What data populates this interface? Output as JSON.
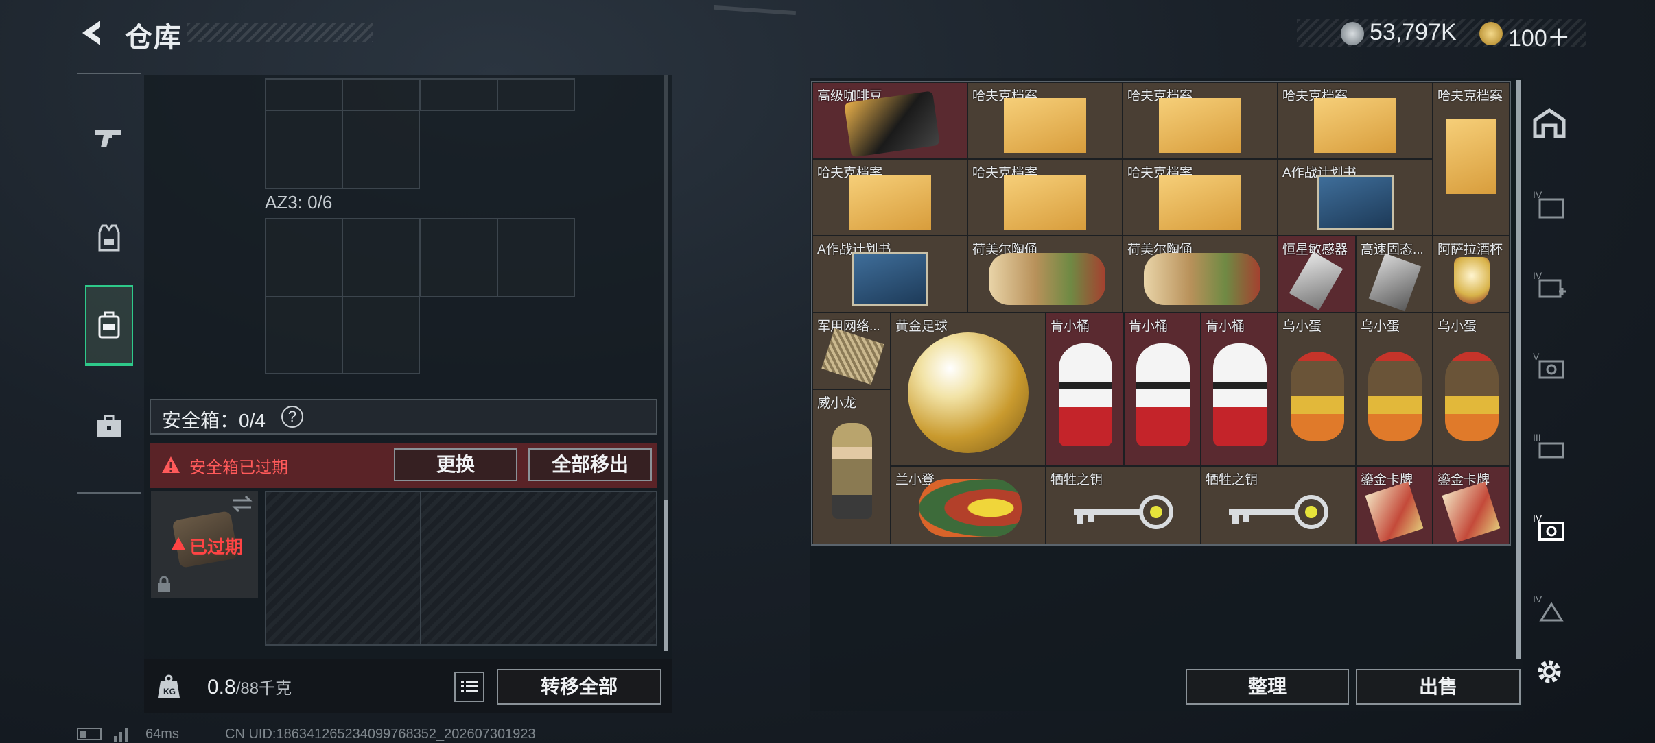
{
  "header": {
    "title": "仓库"
  },
  "currency": {
    "silver": "53,797K",
    "gold": "100＋"
  },
  "left_panel": {
    "container_label": "AZ3: 0/6",
    "safe_box_label": "安全箱：0/4",
    "help": "?",
    "expired_warning": "安全箱已过期",
    "replace_button": "更换",
    "move_all_button": "全部移出",
    "safe_box_status": "已过期",
    "weight_value": "0.8",
    "weight_unit": "/88千克",
    "transfer_all_button": "转移全部"
  },
  "inventory": {
    "items": [
      {
        "label": "高级咖啡豆",
        "color": "red"
      },
      {
        "label": "哈夫克档案",
        "color": "gold"
      },
      {
        "label": "哈夫克档案",
        "color": "gold"
      },
      {
        "label": "哈夫克档案",
        "color": "gold"
      },
      {
        "label": "哈夫克档案",
        "color": "gold"
      },
      {
        "label": "哈夫克档案",
        "color": "gold"
      },
      {
        "label": "哈夫克档案",
        "color": "gold"
      },
      {
        "label": "哈夫克档案",
        "color": "gold"
      },
      {
        "label": "A作战计划书",
        "color": "gold"
      },
      {
        "label": "A作战计划书",
        "color": "gold"
      },
      {
        "label": "荷美尔陶俑",
        "color": "gold"
      },
      {
        "label": "荷美尔陶俑",
        "color": "gold"
      },
      {
        "label": "恒星敏感器",
        "color": "red"
      },
      {
        "label": "高速固态...",
        "color": "gold"
      },
      {
        "label": "阿萨拉酒杯",
        "color": "gold"
      },
      {
        "label": "军用网络...",
        "color": "gold"
      },
      {
        "label": "黄金足球",
        "color": "gold"
      },
      {
        "label": "肯小桶",
        "color": "red"
      },
      {
        "label": "肯小桶",
        "color": "red"
      },
      {
        "label": "肯小桶",
        "color": "red"
      },
      {
        "label": "乌小蛋",
        "color": "gold"
      },
      {
        "label": "乌小蛋",
        "color": "gold"
      },
      {
        "label": "乌小蛋",
        "color": "gold"
      },
      {
        "label": "威小龙",
        "color": "gold"
      },
      {
        "label": "兰小登",
        "color": "gold"
      },
      {
        "label": "牺牲之钥",
        "color": "gold"
      },
      {
        "label": "牺牲之钥",
        "color": "gold"
      },
      {
        "label": "鎏金卡牌",
        "color": "red"
      },
      {
        "label": "鎏金卡牌",
        "color": "red"
      }
    ]
  },
  "actions": {
    "sort_button": "整理",
    "sell_button": "出售"
  },
  "status": {
    "ping": "64ms",
    "uid": "CN UID:18634126523409976835​2_202607301923"
  },
  "colors": {
    "accent": "#2ec98a",
    "gold_slot": "#4a3f34",
    "red_slot": "#5a2a30",
    "warning": "#ff5a5a"
  }
}
